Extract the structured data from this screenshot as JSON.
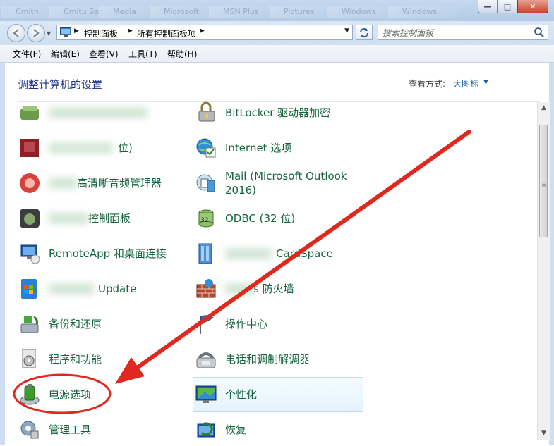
{
  "window": {
    "background_tabs": [
      "Cmitn",
      "Cmitu Ser",
      "Media",
      "Microsoft",
      "MSN Plus",
      "Pictures",
      "Windows",
      "Windows"
    ],
    "controls": {
      "minimize": "—",
      "maximize": "□",
      "close": "✕"
    }
  },
  "address_bar": {
    "breadcrumbs": [
      "控制面板",
      "所有控制面板项"
    ],
    "search_placeholder": "搜索控制面板"
  },
  "menu": [
    "文件(F)",
    "编辑(E)",
    "查看(V)",
    "工具(T)",
    "帮助(H)"
  ],
  "content": {
    "heading": "调整计算机的设置",
    "view_by_label": "查看方式:",
    "view_by_value": "大图标"
  },
  "items_left": [
    {
      "label": "",
      "icon": "obscured-icon"
    },
    {
      "label": "位)",
      "icon": "obscured-icon"
    },
    {
      "label": "高清晰音频管理器",
      "icon": "audio-manager-icon"
    },
    {
      "label": "控制面板",
      "icon": "obscured-icon"
    },
    {
      "label": "RemoteApp 和桌面连接",
      "icon": "remoteapp-icon"
    },
    {
      "label": "Update",
      "icon": "windows-update-icon"
    },
    {
      "label": "备份和还原",
      "icon": "backup-restore-icon"
    },
    {
      "label": "程序和功能",
      "icon": "programs-features-icon"
    },
    {
      "label": "电源选项",
      "icon": "power-options-icon"
    },
    {
      "label": "管理工具",
      "icon": "admin-tools-icon"
    }
  ],
  "items_right": [
    {
      "label": "BitLocker 驱动器加密",
      "icon": "bitlocker-icon"
    },
    {
      "label": "Internet 选项",
      "icon": "internet-options-icon"
    },
    {
      "label": "Mail (Microsoft Outlook 2016)",
      "icon": "mail-icon"
    },
    {
      "label": "ODBC (32 位)",
      "icon": "odbc-icon"
    },
    {
      "label": "CardSpace",
      "icon": "cardspace-icon"
    },
    {
      "label": "s 防火墙",
      "icon": "firewall-icon"
    },
    {
      "label": "操作中心",
      "icon": "action-center-icon"
    },
    {
      "label": "电话和调制解调器",
      "icon": "phone-modem-icon"
    },
    {
      "label": "个性化",
      "icon": "personalization-icon"
    },
    {
      "label": "恢复",
      "icon": "recovery-icon"
    }
  ],
  "accent_colors": {
    "link_green": "#14643f",
    "heading_blue": "#1e3287",
    "annotation_red": "#e0281e"
  }
}
